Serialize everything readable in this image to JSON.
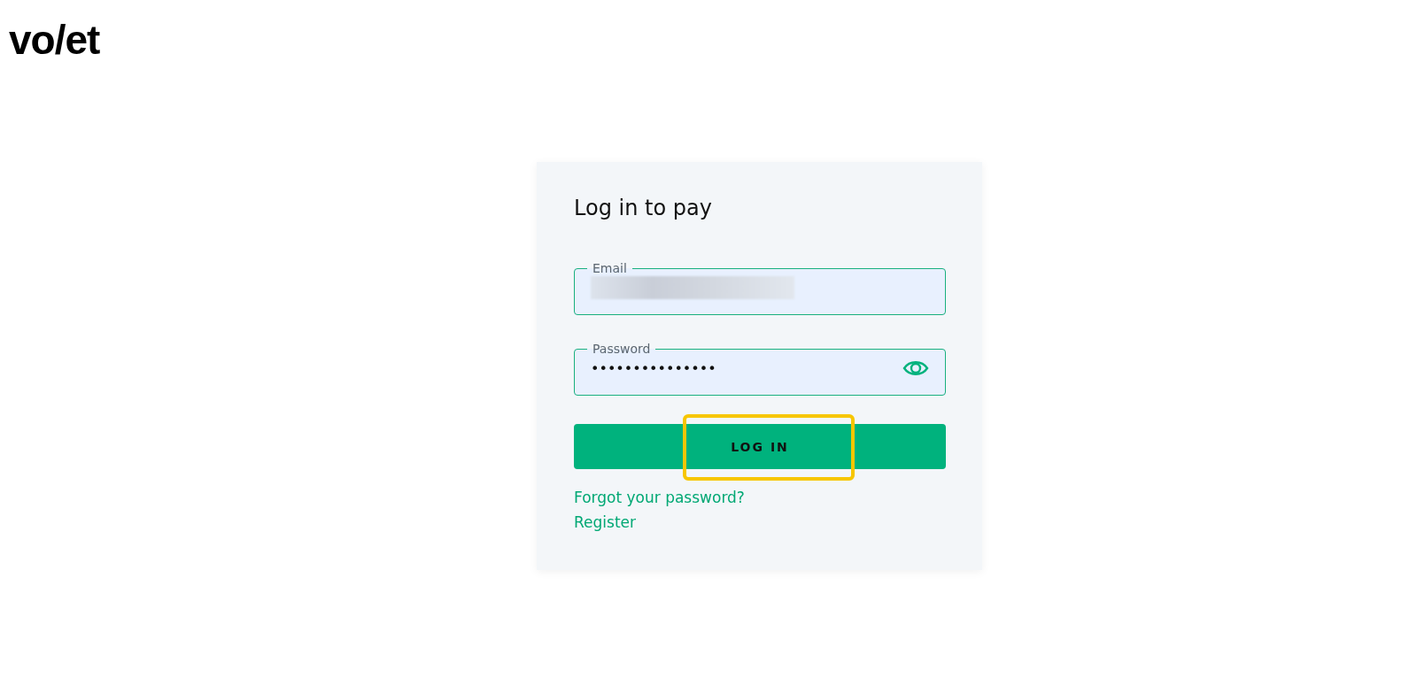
{
  "logo": {
    "text": "vo/et"
  },
  "form": {
    "title": "Log in to pay",
    "fields": [
      {
        "label": "Email",
        "redacted": true
      },
      {
        "label": "Password",
        "value": "•••••••••••••••",
        "reveal_icon": true
      }
    ],
    "submit": {
      "label": "LOG IN",
      "highlighted": true
    },
    "links": [
      "Forgot your password?",
      "Register"
    ]
  }
}
